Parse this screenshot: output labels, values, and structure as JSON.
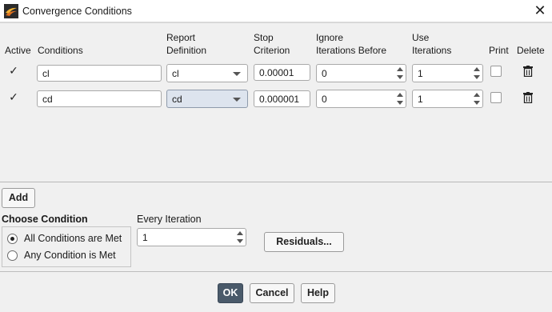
{
  "window": {
    "title": "Convergence Conditions",
    "close_glyph": "✕",
    "app_icon": "fluent-app-icon"
  },
  "table": {
    "headers": {
      "active": "Active",
      "conditions": "Conditions",
      "report_definition_line1": "Report",
      "report_definition_line2": "Definition",
      "stop_criterion_line1": "Stop",
      "stop_criterion_line2": "Criterion",
      "ignore_line1": "Ignore",
      "ignore_line2": "Iterations Before",
      "use_line1": "Use",
      "use_line2": "Iterations",
      "print": "Print",
      "delete": "Delete"
    },
    "rows": [
      {
        "active": true,
        "active_glyph": "✓",
        "condition": "cl",
        "report_definition": "cl",
        "stop_criterion": "0.00001",
        "ignore_iterations_before": "0",
        "use_iterations": "1",
        "print": false
      },
      {
        "active": true,
        "active_glyph": "✓",
        "condition": "cd",
        "report_definition": "cd",
        "stop_criterion": "0.000001",
        "ignore_iterations_before": "0",
        "use_iterations": "1",
        "print": false
      }
    ]
  },
  "add_button": "Add",
  "choose_condition": {
    "title": "Choose Condition",
    "options": [
      "All Conditions are Met",
      "Any Condition is Met"
    ],
    "selected": "All Conditions are Met"
  },
  "every_iteration": {
    "label": "Every Iteration",
    "value": "1"
  },
  "residuals_button": "Residuals...",
  "footer": {
    "ok": "OK",
    "cancel": "Cancel",
    "help": "Help"
  },
  "colors": {
    "primary_button": "#4a5a6a",
    "selected_combo": "#dde4ee",
    "background": "#f0f0f0"
  }
}
